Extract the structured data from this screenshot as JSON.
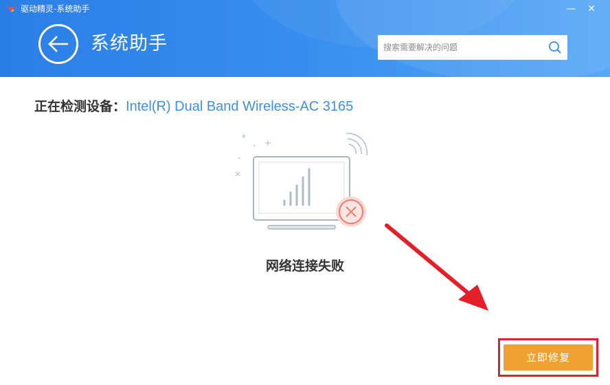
{
  "window": {
    "app_title": "驱动精灵-系统助手",
    "minimize_glyph": "—",
    "close_glyph": "✕"
  },
  "header": {
    "page_title": "系统助手",
    "back_icon": "arrow-left-icon"
  },
  "search": {
    "placeholder": "搜索需要解决的问题",
    "value": "",
    "icon": "search-icon"
  },
  "detection": {
    "label": "正在检测设备：",
    "device": "Intel(R) Dual Band Wireless-AC 3165"
  },
  "status": {
    "text": "网络连接失败",
    "icon": "monitor-wifi-error-icon"
  },
  "actions": {
    "fix_label": "立即修复"
  },
  "colors": {
    "header_blue": "#2f86ea",
    "device_blue": "#3d8fe0",
    "fix_button": "#eea130",
    "highlight_red": "#e3202a",
    "error_red": "#f07a6c"
  }
}
